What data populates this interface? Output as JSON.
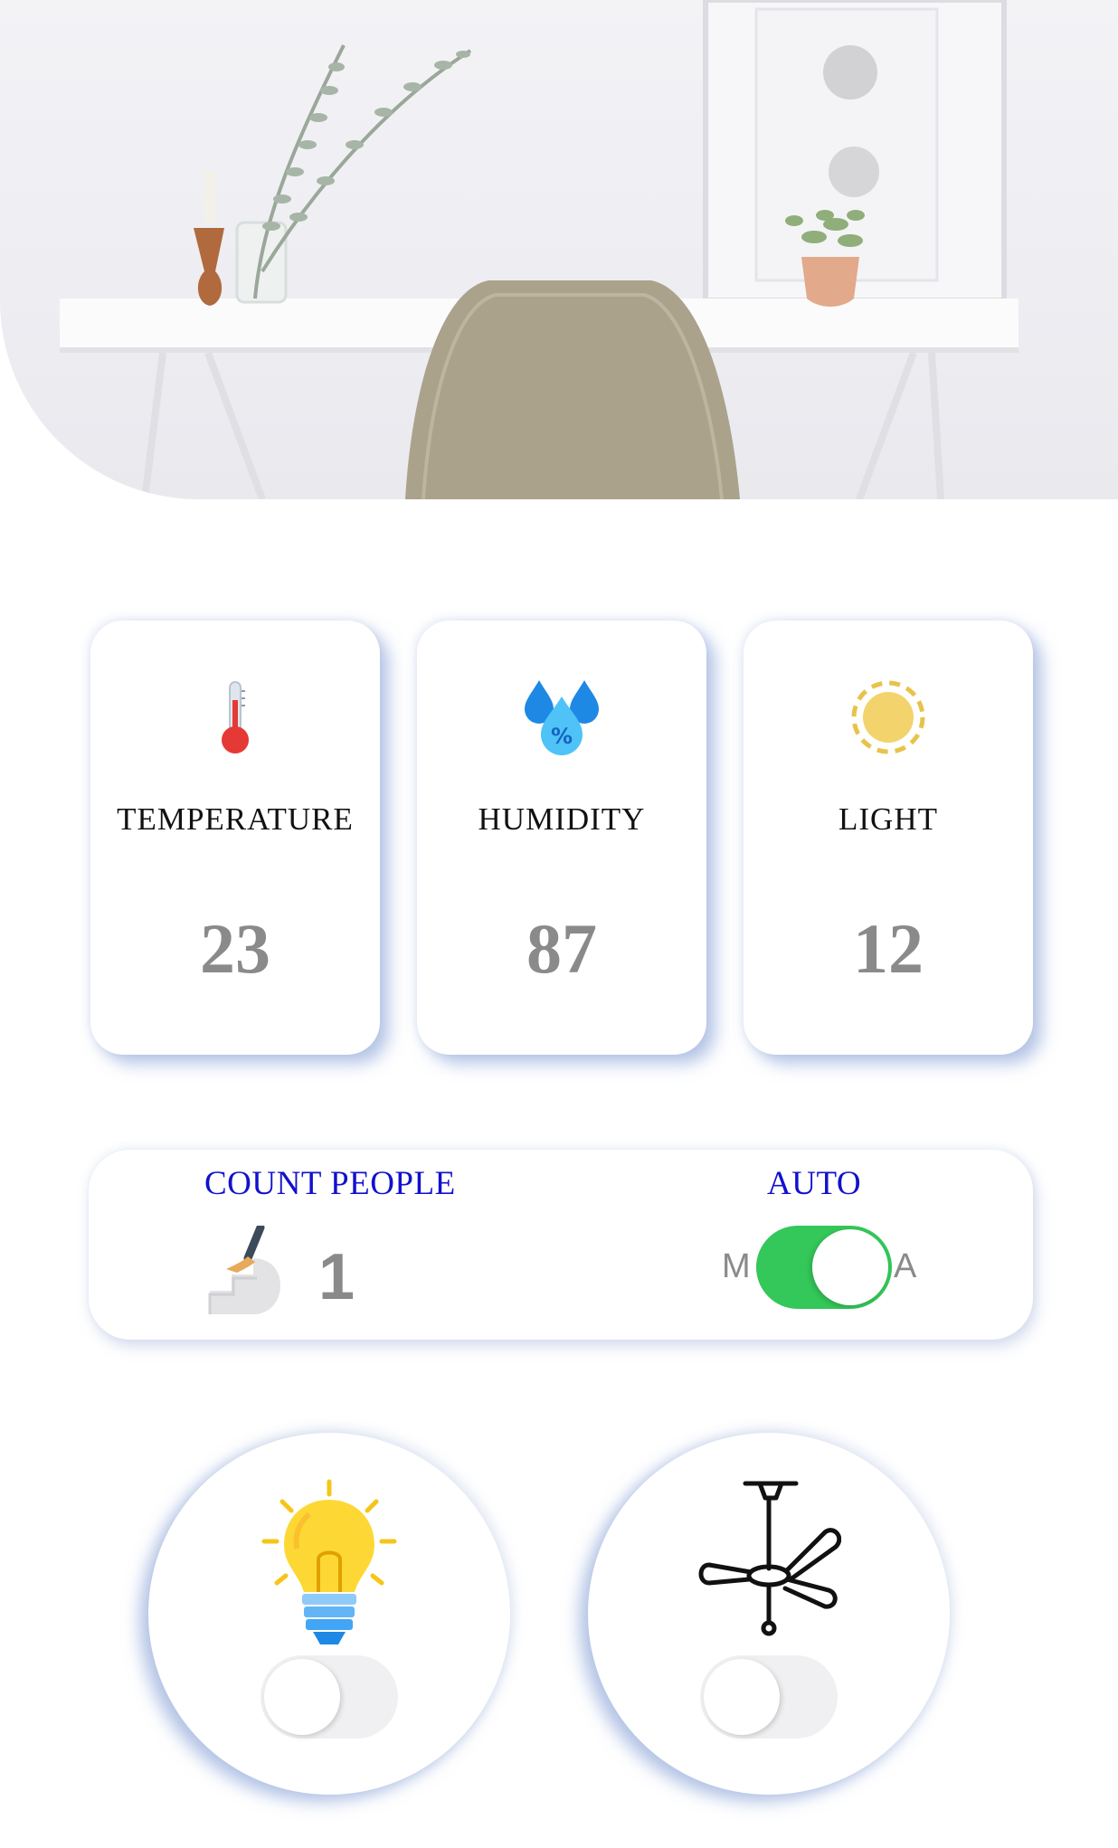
{
  "hero": {
    "image": "desk-with-chair-photo"
  },
  "sensors": [
    {
      "label": "TEMPERATURE",
      "value": "23",
      "icon": "thermometer-icon"
    },
    {
      "label": "HUMIDITY",
      "value": "87",
      "icon": "humidity-drops-icon"
    },
    {
      "label": "LIGHT",
      "value": "12",
      "icon": "sun-icon"
    }
  ],
  "count": {
    "title": "COUNT PEOPLE",
    "value": "1",
    "icon": "stairs-person-icon"
  },
  "mode": {
    "title": "AUTO",
    "left_label": "M",
    "right_label": "A",
    "state": "on",
    "on_color": "#34c759"
  },
  "devices": [
    {
      "name": "light",
      "icon": "light-bulb-icon",
      "state": "off"
    },
    {
      "name": "fan",
      "icon": "ceiling-fan-icon",
      "state": "off"
    }
  ],
  "colors": {
    "title_blue": "#1111cc",
    "value_gray": "#8a8a8a",
    "card_shadow": "#7896d2"
  }
}
